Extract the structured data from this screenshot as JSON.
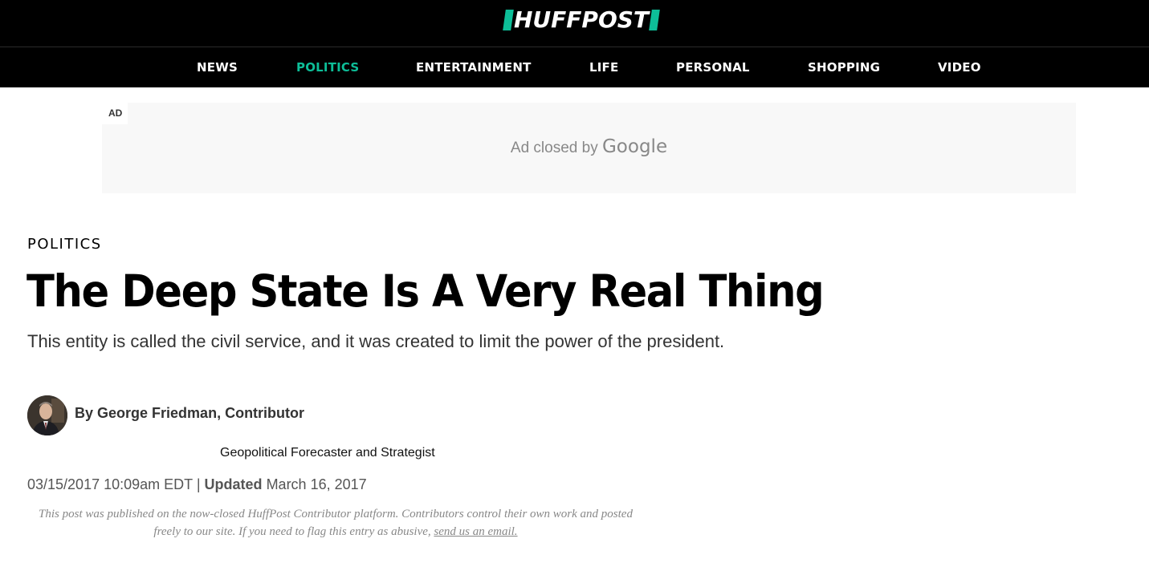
{
  "header": {
    "logo_text": "HUFFPOST",
    "accent_color": "#0dbe98",
    "background_color": "#000000"
  },
  "nav": {
    "items": [
      {
        "label": "NEWS",
        "active": false
      },
      {
        "label": "POLITICS",
        "active": true
      },
      {
        "label": "ENTERTAINMENT",
        "active": false
      },
      {
        "label": "LIFE",
        "active": false
      },
      {
        "label": "PERSONAL",
        "active": false
      },
      {
        "label": "SHOPPING",
        "active": false
      },
      {
        "label": "VIDEO",
        "active": false
      }
    ]
  },
  "ad": {
    "label": "AD",
    "closed_text": "Ad closed by",
    "brand": "Google"
  },
  "article": {
    "section": "POLITICS",
    "headline": "The Deep State Is A Very Real Thing",
    "dek": "This entity is called the civil service, and it was created to limit the power of the president.",
    "author": {
      "byline_prefix": "By",
      "name": "George Friedman, Contributor",
      "bio": "Geopolitical Forecaster and Strategist",
      "avatar_icon": "author-photo"
    },
    "timestamp": {
      "published": "03/15/2017 10:09am EDT",
      "separator": "|",
      "updated_label": "Updated",
      "updated_date": "March 16, 2017"
    },
    "disclaimer": {
      "text": "This post was published on the now-closed HuffPost Contributor platform. Contributors control their own work and posted freely to our site. If you need to flag this entry as abusive,",
      "link_text": "send us an email."
    }
  }
}
